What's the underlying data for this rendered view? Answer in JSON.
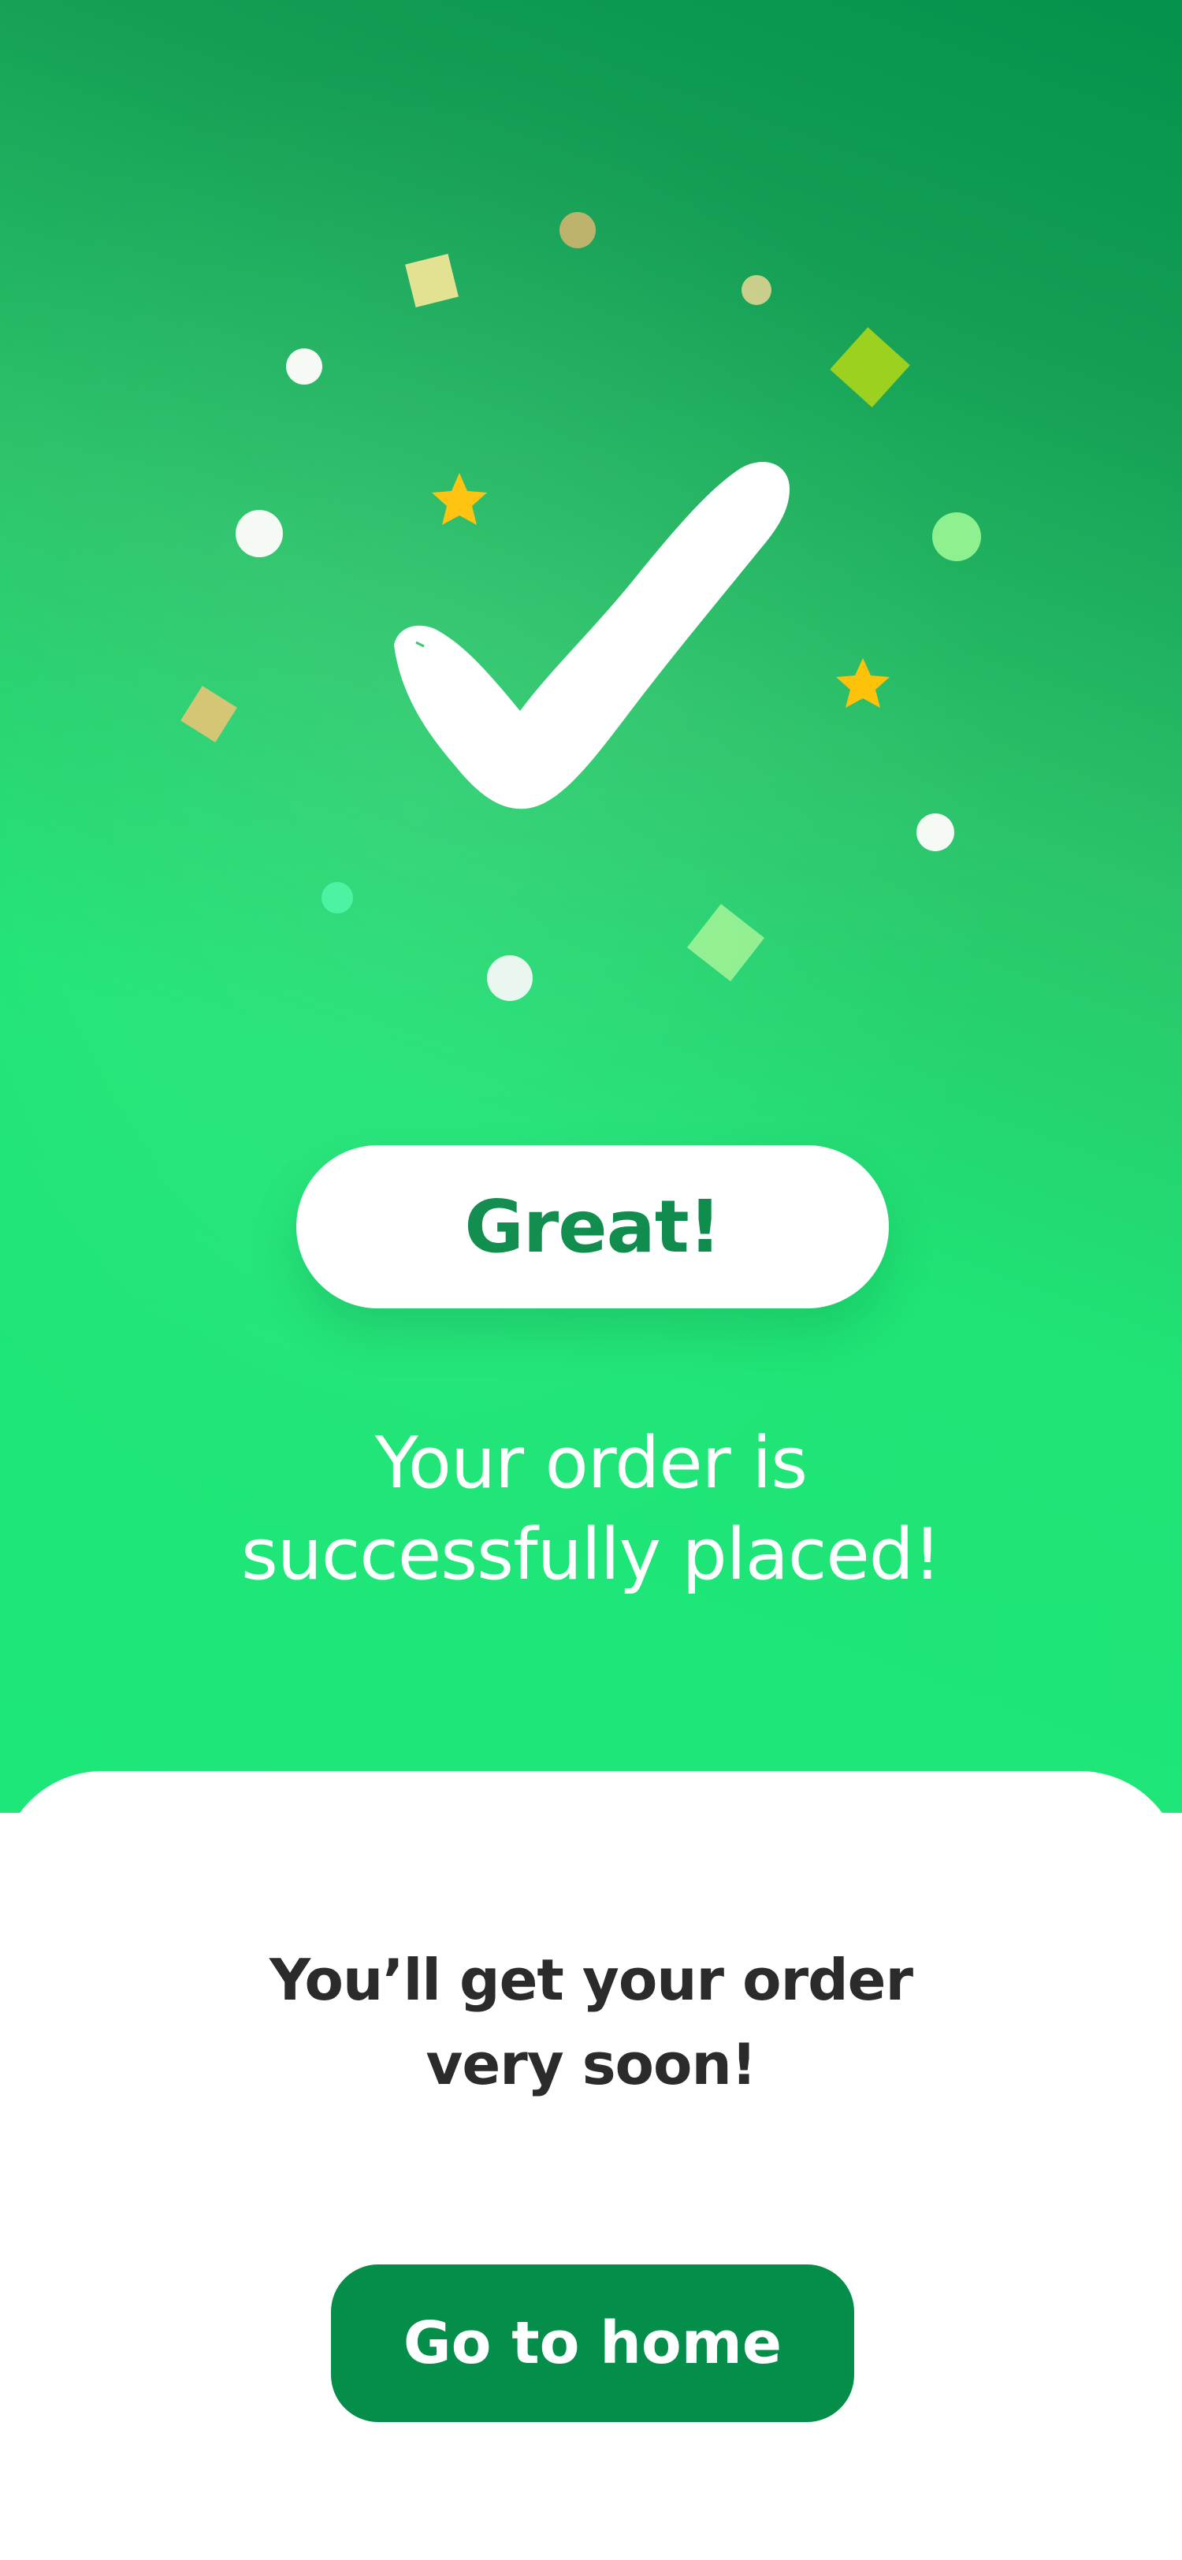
{
  "hero": {
    "status_icon": "checkmark-icon",
    "decorations": [
      "confetti-dot-icon",
      "confetti-square-icon",
      "star-icon"
    ],
    "great_label": "Great!",
    "headline_line1": "Your order is",
    "headline_line2": "successfully placed!"
  },
  "sheet": {
    "message_line1": "You’ll get your order",
    "message_line2": "very soon!",
    "home_button_label": "Go to home"
  },
  "colors": {
    "brand_green": "#058d4a",
    "accent_green": "#1ee77a",
    "star_yellow": "#ffc107",
    "text_dark": "#2b2b2b"
  }
}
